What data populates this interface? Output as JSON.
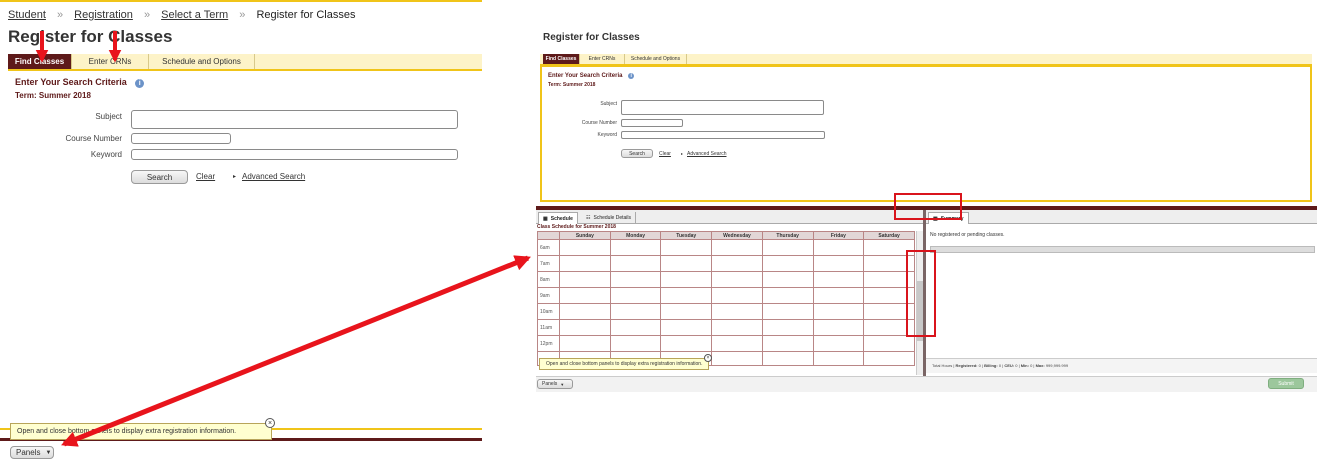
{
  "left": {
    "breadcrumb": [
      "Student",
      "Registration",
      "Select a Term",
      "Register for Classes"
    ],
    "breadcrumb_separator": "»",
    "page_title": "Register for Classes",
    "tabs": [
      "Find Classes",
      "Enter CRNs",
      "Schedule and Options"
    ],
    "search": {
      "heading": "Enter Your Search Criteria",
      "term": "Term: Summer 2018",
      "subject_label": "Subject",
      "course_number_label": "Course Number",
      "keyword_label": "Keyword",
      "search_button": "Search",
      "clear_link": "Clear",
      "advanced_search": "Advanced Search"
    },
    "tooltip": "Open and close bottom panels to display extra registration information.",
    "panels_button": "Panels"
  },
  "right": {
    "page_title": "Register for Classes",
    "tabs": [
      "Find Classes",
      "Enter CRNs",
      "Schedule and Options"
    ],
    "search": {
      "heading": "Enter Your Search Criteria",
      "term": "Term: Summer 2018",
      "subject_label": "Subject",
      "course_number_label": "Course Number",
      "keyword_label": "Keyword",
      "search_button": "Search",
      "clear_link": "Clear",
      "advanced_search": "Advanced Search"
    },
    "bottom_tabs": [
      "Schedule",
      "Schedule Details"
    ],
    "schedule_title": "Class Schedule for Summer 2018",
    "days": [
      "Sunday",
      "Monday",
      "Tuesday",
      "Wednesday",
      "Thursday",
      "Friday",
      "Saturday"
    ],
    "hours": [
      "6am",
      "7am",
      "8am",
      "9am",
      "10am",
      "11am",
      "12pm"
    ],
    "summary_tab": "Summary",
    "summary_empty": "No registered or pending classes.",
    "tooltip": "Open and close bottom panels to display extra registration information.",
    "panels_button": "Panels",
    "totals": {
      "label": "Total Hours",
      "registered_label": "Registered:",
      "registered": "0",
      "billing_label": "Billing:",
      "billing": "0",
      "ceu_label": "CEU:",
      "ceu": "0",
      "min_label": "Min:",
      "min": "0",
      "max_label": "Max:",
      "max": "999,999.999"
    },
    "submit_button": "Submit"
  },
  "colors": {
    "tab_active": "#5e1a1a",
    "tab_bar": "#fdf3c8",
    "accent_gold": "#f0c419",
    "arrow_red": "#e8141c",
    "highlight_red": "#d9141c",
    "grid_line": "#b98686"
  },
  "icons": {
    "info": "info-icon",
    "caret": "caret-down-icon",
    "calendar": "calendar-icon",
    "grid": "grid-icon",
    "close": "close-icon",
    "triangle": "triangle-right-icon"
  }
}
